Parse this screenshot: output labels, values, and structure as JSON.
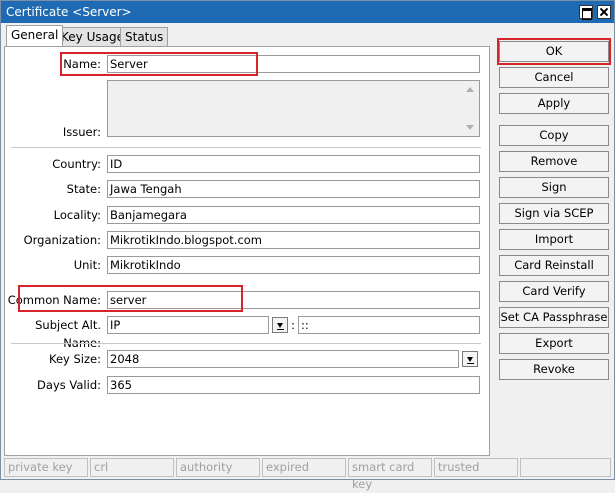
{
  "window": {
    "title": "Certificate <Server>"
  },
  "tabs": [
    {
      "label": "General",
      "active": true
    },
    {
      "label": "Key Usage"
    },
    {
      "label": "Status"
    }
  ],
  "form": {
    "name": {
      "label": "Name:",
      "value": "Server"
    },
    "issuer": {
      "label": "Issuer:",
      "value": ""
    },
    "country": {
      "label": "Country:",
      "value": "ID"
    },
    "state": {
      "label": "State:",
      "value": "Jawa Tengah"
    },
    "locality": {
      "label": "Locality:",
      "value": "Banjamegara"
    },
    "organization": {
      "label": "Organization:",
      "value": "MikrotikIndo.blogspot.com"
    },
    "unit": {
      "label": "Unit:",
      "value": "MikrotikIndo"
    },
    "common_name": {
      "label": "Common Name:",
      "value": "server"
    },
    "subject_alt_name": {
      "label": "Subject Alt. Name:",
      "type_value": "IP",
      "separator": ":",
      "value": "::"
    },
    "key_size": {
      "label": "Key Size:",
      "value": "2048"
    },
    "days_valid": {
      "label": "Days Valid:",
      "value": "365"
    }
  },
  "buttons": [
    "OK",
    "Cancel",
    "Apply",
    "Copy",
    "Remove",
    "Sign",
    "Sign via SCEP",
    "Import",
    "Card Reinstall",
    "Card Verify",
    "Set CA Passphrase",
    "Export",
    "Revoke"
  ],
  "status_bar": [
    "private key",
    "crl",
    "authority",
    "expired",
    "smart card key",
    "trusted",
    ""
  ],
  "colors": {
    "title_bar": "#1f6bb3",
    "highlight": "#d9232b"
  }
}
